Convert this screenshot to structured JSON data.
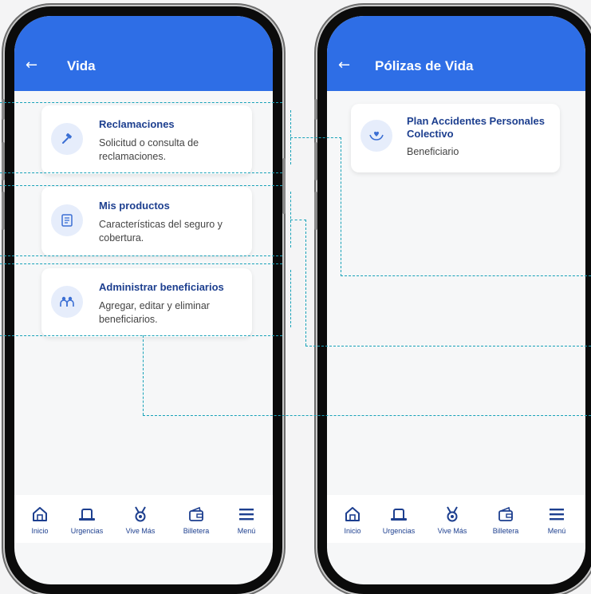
{
  "left_screen": {
    "header": {
      "back_icon": "←",
      "title": "Vida"
    },
    "cards": [
      {
        "icon": "gavel-icon",
        "title": "Reclamaciones",
        "desc_lines": [
          "Solicitud o consulta de",
          "reclamaciones."
        ]
      },
      {
        "icon": "document-icon",
        "title": "Mis productos",
        "desc_lines": [
          "Características del seguro y",
          "cobertura."
        ]
      },
      {
        "icon": "people-icon",
        "title": "Administrar beneficiarios",
        "desc_lines": [
          "Agregar, editar y eliminar",
          "beneficiarios."
        ]
      }
    ]
  },
  "right_screen": {
    "header": {
      "back_icon": "←",
      "title": "Pólizas de Vida"
    },
    "cards": [
      {
        "icon": "hands-heart-icon",
        "title_lines": [
          "Plan Accidentes Personales",
          "Colectivo"
        ],
        "desc": "Beneficiario"
      }
    ]
  },
  "navbar": {
    "items": [
      {
        "icon": "home-icon",
        "label": "Inicio"
      },
      {
        "icon": "ambulance-icon",
        "label": "Urgencias"
      },
      {
        "icon": "medal-icon",
        "label": "Vive Más"
      },
      {
        "icon": "wallet-icon",
        "label": "Billetera"
      },
      {
        "icon": "menu-icon",
        "label": "Menú"
      }
    ]
  },
  "colors": {
    "primary_blue": "#2e6ee6",
    "title_navy": "#1d3f8f",
    "flow_line_teal": "#17a2b8"
  }
}
